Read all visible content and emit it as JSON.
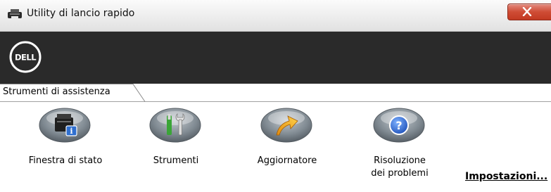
{
  "window": {
    "title": "Utility di lancio rapido",
    "brand": "DELL"
  },
  "tabs": [
    {
      "label": "Strumenti di assistenza",
      "selected": true
    }
  ],
  "tools": [
    {
      "label": "Finestra di stato",
      "icon": "printer-info-icon"
    },
    {
      "label": "Strumenti",
      "icon": "tools-icon"
    },
    {
      "label": "Aggiornatore",
      "icon": "arrow-update-icon"
    },
    {
      "label_line1": "Risoluzione",
      "label_line2": "dei problemi",
      "icon": "help-icon"
    }
  ],
  "settings_link": "Impostazioni...",
  "colors": {
    "banner": "#2a2a2a",
    "close_button": "#c8442c",
    "pill_gray": "#808a92"
  }
}
